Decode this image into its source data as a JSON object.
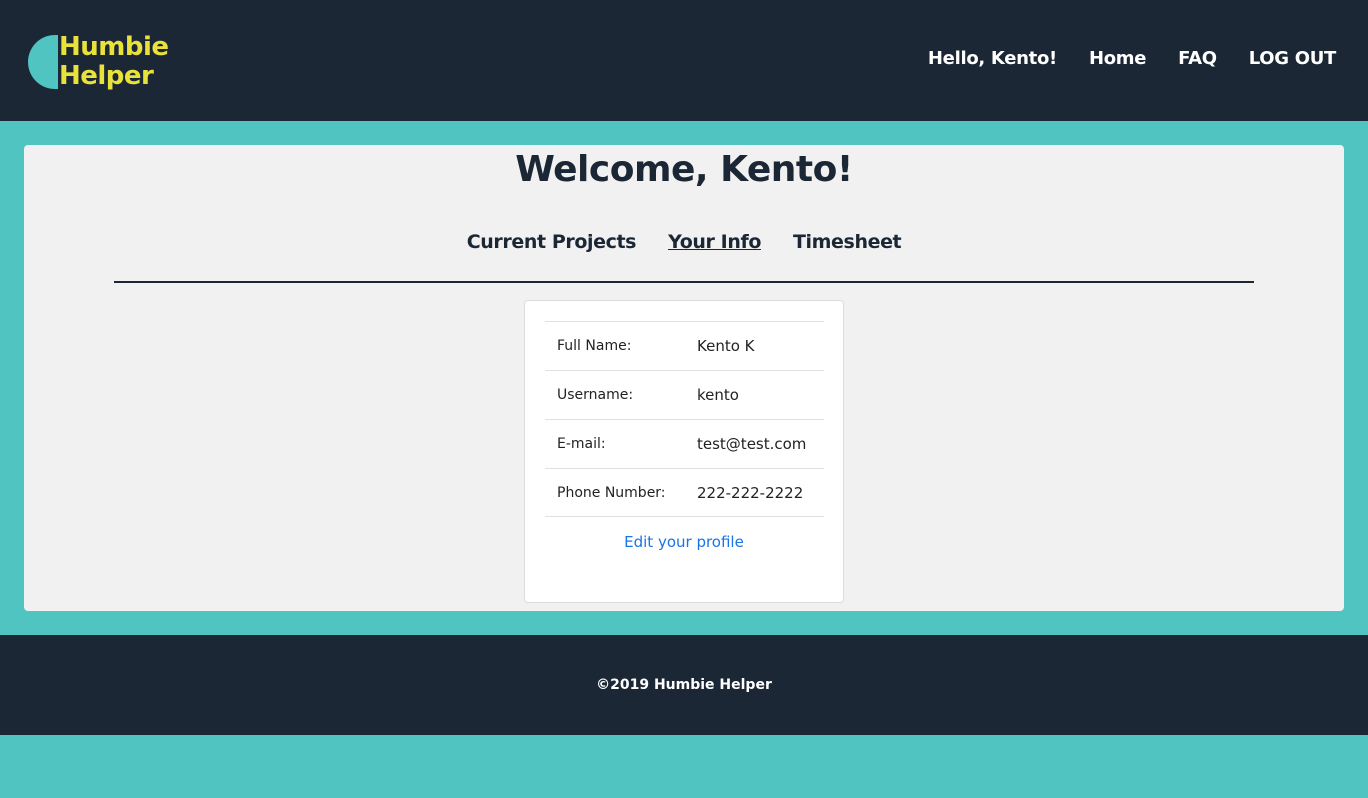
{
  "header": {
    "logo": {
      "line1": "Humbie",
      "line2": "Helper"
    },
    "nav": {
      "greeting": "Hello, Kento!",
      "home": "Home",
      "faq": "FAQ",
      "logout": "LOG OUT"
    }
  },
  "main": {
    "title": "Welcome, Kento!",
    "tabs": [
      {
        "label": "Current Projects",
        "active": false
      },
      {
        "label": "Your Info",
        "active": true
      },
      {
        "label": "Timesheet",
        "active": false
      }
    ],
    "info": [
      {
        "label": "Full Name:",
        "value": "Kento K"
      },
      {
        "label": "Username:",
        "value": "kento"
      },
      {
        "label": "E-mail:",
        "value": "test@test.com"
      },
      {
        "label": "Phone Number:",
        "value": "222-222-2222"
      }
    ],
    "edit_link": "Edit your profile"
  },
  "footer": {
    "copyright": "©2019 Humbie Helper"
  },
  "colors": {
    "header_bg": "#1c2735",
    "page_bg": "#50c4c0",
    "panel_bg": "#f1f1f1",
    "logo_text": "#e8e23a",
    "link": "#1b74e4"
  }
}
